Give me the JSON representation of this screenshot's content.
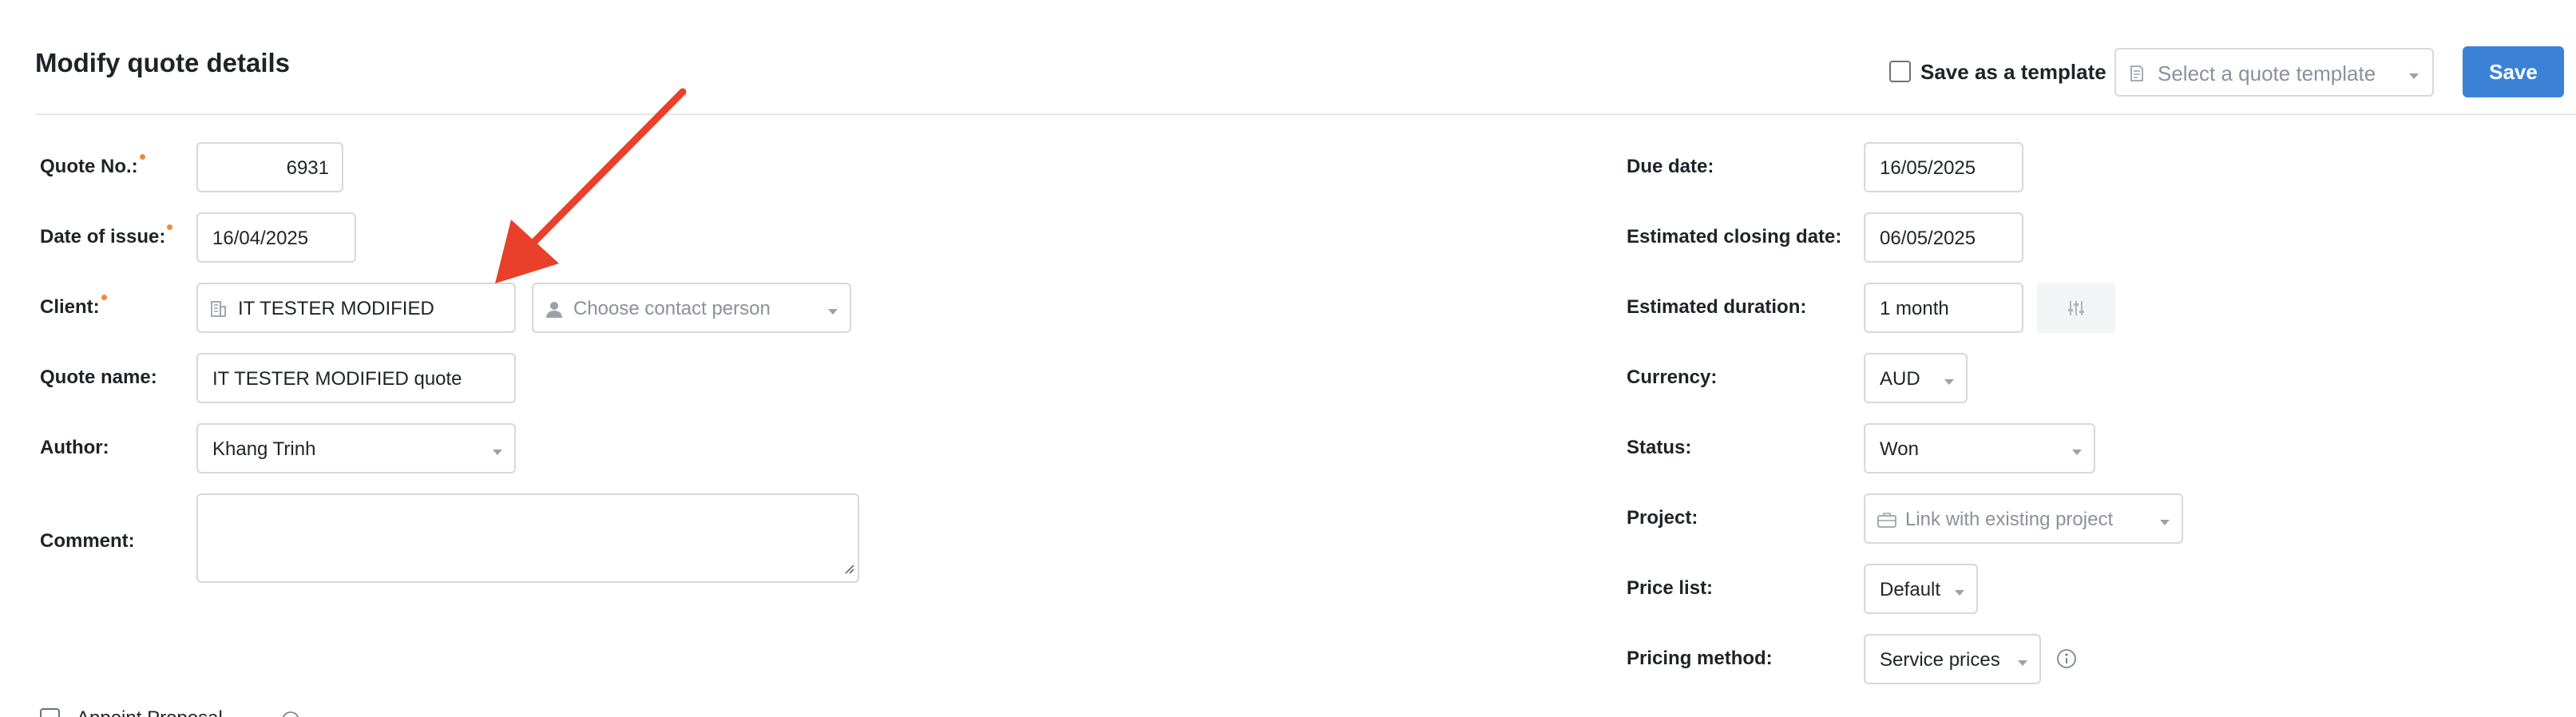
{
  "header": {
    "title": "Modify quote details",
    "save_template_label": "Save as a template",
    "template_select_placeholder": "Select a quote template",
    "save_label": "Save"
  },
  "left": {
    "quote_no": {
      "label": "Quote No.:",
      "value": "6931"
    },
    "date_of_issue": {
      "label": "Date of issue:",
      "value": "16/04/2025"
    },
    "client": {
      "label": "Client:",
      "value": "IT TESTER MODIFIED",
      "contact_placeholder": "Choose contact person"
    },
    "quote_name": {
      "label": "Quote name:",
      "value": "IT TESTER MODIFIED quote"
    },
    "author": {
      "label": "Author:",
      "value": "Khang Trinh"
    },
    "comment": {
      "label": "Comment:",
      "value": ""
    }
  },
  "right": {
    "due_date": {
      "label": "Due date:",
      "value": "16/05/2025"
    },
    "estimated_closing_date": {
      "label": "Estimated closing date:",
      "value": "06/05/2025"
    },
    "estimated_duration": {
      "label": "Estimated duration:",
      "value": "1 month"
    },
    "currency": {
      "label": "Currency:",
      "value": "AUD"
    },
    "status": {
      "label": "Status:",
      "value": "Won"
    },
    "project": {
      "label": "Project:",
      "placeholder": "Link with existing project"
    },
    "price_list": {
      "label": "Price list:",
      "value": "Default"
    },
    "pricing_method": {
      "label": "Pricing method:",
      "value": "Service prices"
    }
  },
  "bottom": {
    "partial_text": "Appoint Proposal"
  },
  "colors": {
    "accent": "#3b82d6",
    "required_dot": "#f08a3a",
    "annotation_arrow": "#e8402a"
  },
  "icons": {
    "template": "document-template-icon",
    "building": "building-icon",
    "person": "person-icon",
    "briefcase": "briefcase-icon",
    "sliders": "sliders-icon",
    "info": "info-icon",
    "caret": "chevron-down-icon",
    "arrow": "annotation-arrow-icon"
  }
}
